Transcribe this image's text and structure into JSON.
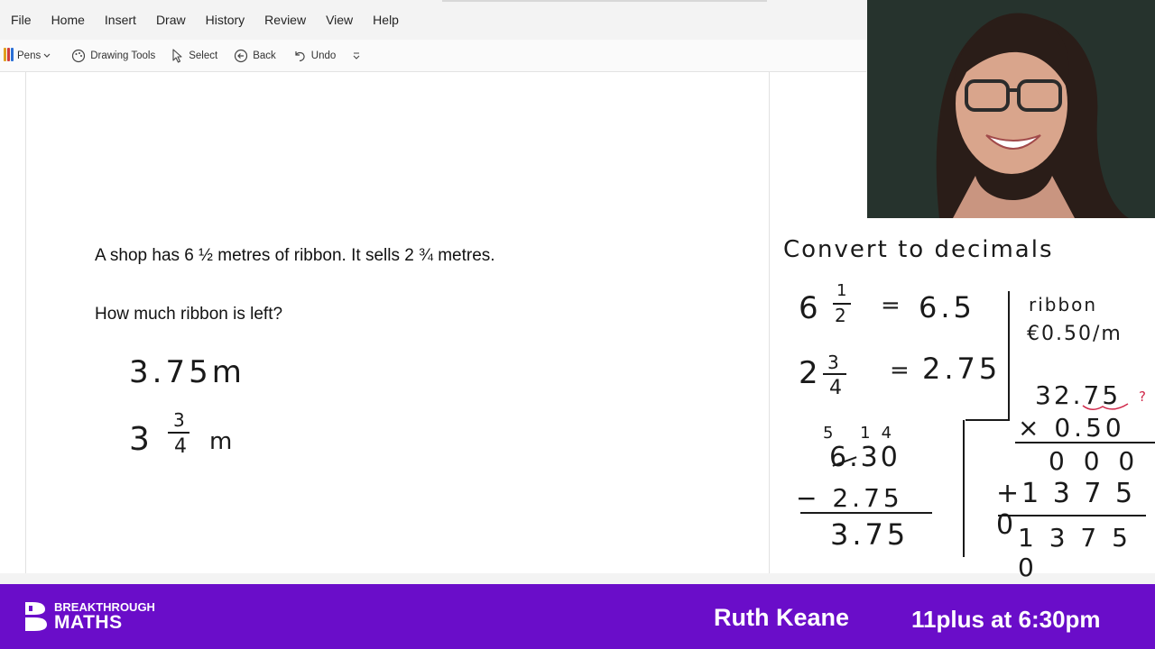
{
  "menu": {
    "items": [
      {
        "label": "File"
      },
      {
        "label": "Home"
      },
      {
        "label": "Insert"
      },
      {
        "label": "Draw"
      },
      {
        "label": "History"
      },
      {
        "label": "Review"
      },
      {
        "label": "View"
      },
      {
        "label": "Help"
      }
    ]
  },
  "toolbar": {
    "pens_label": "Pens",
    "pens_icon": "pens-icon",
    "drawing_tools_label": "Drawing Tools",
    "select_label": "Select",
    "back_label": "Back",
    "undo_label": "Undo"
  },
  "question": {
    "line1": "A shop has 6 ½ metres of ribbon. It sells 2 ¾ metres.",
    "line2": "How much ribbon is left?"
  },
  "answer_work": {
    "decimal": "3.75m",
    "mixed_whole": "3",
    "mixed_num": "3",
    "mixed_den": "4",
    "mixed_unit": "m"
  },
  "side_work": {
    "heading": "Convert to decimals",
    "c1_whole": "6",
    "c1_num": "1",
    "c1_den": "2",
    "c1_eq": "=",
    "c1_value": "6.5",
    "c2_whole": "2",
    "c2_num": "3",
    "c2_den": "4",
    "c2_eq": "=",
    "c2_value": "2.75",
    "sub_carry": "5 14",
    "sub_top": "6.30",
    "sub_minus": "− 2.75",
    "sub_result": "3.75",
    "ribbon_label": "ribbon",
    "ribbon_price": "€0.50/m",
    "mult_top": "32.75",
    "mult_mark": "?",
    "mult_second": "× 0.50",
    "mult_row1": "0 0 0",
    "mult_row2": "+1 3 7 5 0",
    "mult_result": "1 3 7 5 0"
  },
  "footer": {
    "brand_line1": "BREAKTHROUGH",
    "brand_line2": "MATHS",
    "presenter": "Ruth Keane",
    "schedule": "11plus at 6:30pm"
  },
  "colors": {
    "footer_bg": "#6a0dc9",
    "ink": "#1a1a1a",
    "red_ink": "#d0284a"
  }
}
